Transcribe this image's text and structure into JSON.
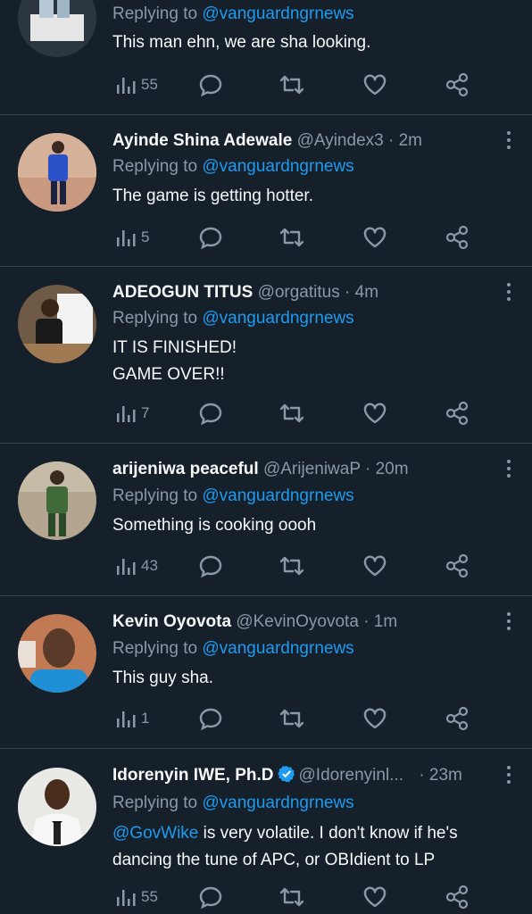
{
  "tweets": [
    {
      "name": "",
      "handle": "",
      "time": "",
      "replying_prefix": "Replying to",
      "replying_to": "@vanguardngrnews",
      "text_lines": [
        "This man ehn, we are sha looking."
      ],
      "views": "55",
      "avatar_color": "#3a4a55"
    },
    {
      "name": "Ayinde Shina Adewale",
      "handle": "@Ayindex3",
      "time": "2m",
      "replying_prefix": "Replying to",
      "replying_to": "@vanguardngrnews",
      "text_lines": [
        "The game is getting hotter."
      ],
      "views": "5",
      "avatar_color": "#d9b8a3"
    },
    {
      "name": "ADEOGUN TITUS",
      "handle": "@orgatitus",
      "time": "4m",
      "replying_prefix": "Replying to",
      "replying_to": "@vanguardngrnews",
      "text_lines": [
        "IT IS FINISHED!",
        "GAME OVER!!"
      ],
      "views": "7",
      "avatar_color": "#8a6a4a"
    },
    {
      "name": "arijeniwa peaceful",
      "handle": "@ArijeniwaP",
      "time": "20m",
      "replying_prefix": "Replying to",
      "replying_to": "@vanguardngrnews",
      "text_lines": [
        "Something is cooking oooh"
      ],
      "views": "43",
      "avatar_color": "#a79a86"
    },
    {
      "name": "Kevin Oyovota",
      "handle": "@KevinOyovota",
      "time": "1m",
      "replying_prefix": "Replying to",
      "replying_to": "@vanguardngrnews",
      "text_lines": [
        "This guy sha."
      ],
      "views": "1",
      "avatar_color": "#c9744a"
    },
    {
      "name": "Idorenyin IWE, Ph.D",
      "handle": "@Idorenyinl...",
      "time": "23m",
      "replying_prefix": "Replying to",
      "replying_to": "@vanguardngrnews",
      "text_mention": "@GovWike",
      "text_lines": [
        " is very volatile. I don't know if he's",
        "dancing the tune of APC, or OBIdient to LP"
      ],
      "views": "55",
      "avatar_color": "#e8e8e8",
      "verified": true
    }
  ],
  "colors": {
    "background": "#15202b",
    "divider": "#38444d",
    "secondary_text": "#8b98a5",
    "link": "#1d9bf0",
    "verified": "#1d9bf0"
  },
  "separator": "·"
}
